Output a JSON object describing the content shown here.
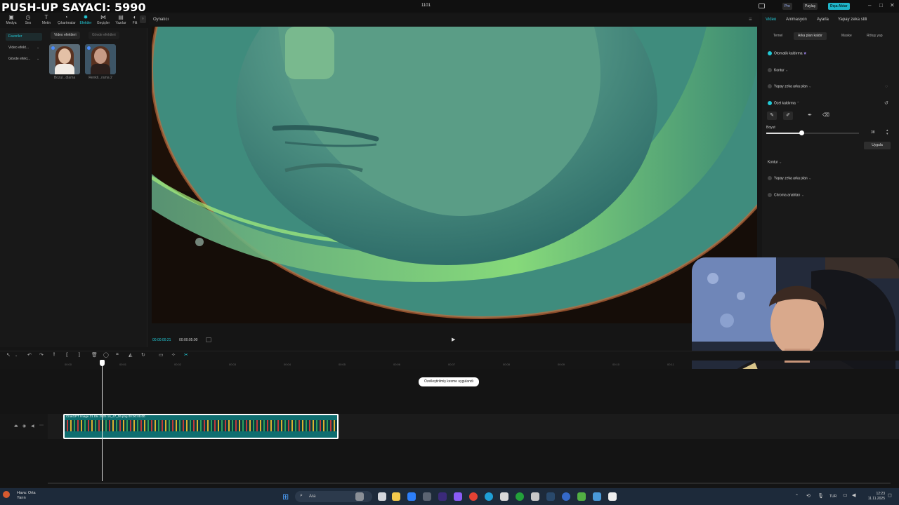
{
  "overlay": {
    "pushup_counter": "PUSH-UP SAYACI: 5990"
  },
  "titlebar": {
    "project_title": "1101",
    "pro_label": "Pro",
    "share_label": "Paylaş",
    "export_label": "Dışa Aktar"
  },
  "media_tools": [
    {
      "label": "Medya",
      "icon": "media-icon"
    },
    {
      "label": "Ses",
      "icon": "audio-icon"
    },
    {
      "label": "Metin",
      "icon": "text-icon"
    },
    {
      "label": "Çıkartmalar",
      "icon": "sticker-icon"
    },
    {
      "label": "Efektler",
      "icon": "effects-icon",
      "active": true
    },
    {
      "label": "Geçişler",
      "icon": "transitions-icon"
    },
    {
      "label": "Yazılar",
      "icon": "captions-icon"
    },
    {
      "label": "Filt",
      "icon": "filters-icon"
    }
  ],
  "left_panel": {
    "side_items": [
      "Favoriler",
      "Video efekt...",
      "Gövde efekt..."
    ],
    "chips": [
      "Video efektleri",
      "Gövde efektleri"
    ],
    "thumbs": [
      "Bozul...dlama",
      "Renkli...rama 2"
    ]
  },
  "player": {
    "label": "Oynatıcı",
    "time_current": "00:00:00:21",
    "time_total": "00:00:05:00"
  },
  "right_panel": {
    "tabs": [
      "Video",
      "Animasyon",
      "Ayarla",
      "Yapay zeka stili"
    ],
    "subtabs": [
      "Temel",
      "Arka plan kaldır",
      "Maske",
      "Rötuş yap"
    ],
    "options": {
      "auto_remove": "Otomatik kaldırma",
      "contour1": "Kontur",
      "ai_bg1": "Yapay zeka arka plan",
      "custom_remove": "Özel kaldırma",
      "contour2": "Kontur",
      "ai_bg2": "Yapay zeka arka plan",
      "chroma": "Chroma anahtarı"
    },
    "size_label": "Boyut",
    "size_value": "38",
    "size_fraction": 0.38,
    "apply_label": "Uygula"
  },
  "timeline": {
    "ruler": [
      "00:00",
      "00:01",
      "00:02",
      "00:03",
      "00:04",
      "00:05",
      "00:06",
      "00:07",
      "00:08",
      "00:09",
      "00:10",
      "00:11"
    ],
    "clip_title": "ChatGPT Image 31 Eki 2025 16_47_06.png   00:00:05:00",
    "cover_label": "Kapak",
    "toast": "Özelleştirilmiş kesme uygulandı"
  },
  "taskbar": {
    "weather_title": "Hava: Orta",
    "weather_sub": "Yarın",
    "search_placeholder": "Ara",
    "lang": "TUR",
    "time": "12:23",
    "date": "11.11.2025"
  },
  "colors": {
    "accent": "#22c9d6",
    "clip": "#0f6e70",
    "export": "#1fb5c9"
  }
}
